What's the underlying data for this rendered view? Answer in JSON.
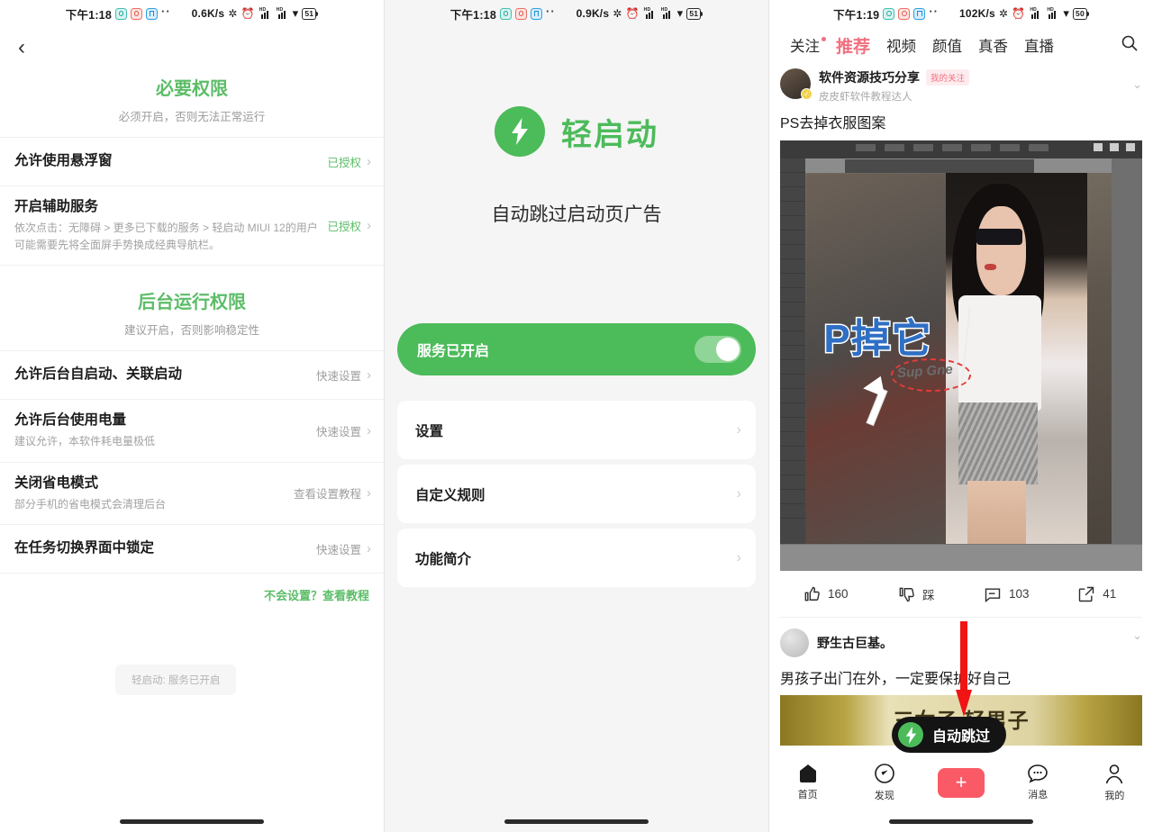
{
  "panel1": {
    "status": {
      "time": "下午1:18",
      "speed": "0.6K/s",
      "battery": "51"
    },
    "back_icon": "‹",
    "section1": {
      "title": "必要权限",
      "subtitle": "必须开启，否则无法正常运行"
    },
    "rows1": [
      {
        "title": "允许使用悬浮窗",
        "desc": "",
        "action": "已授权",
        "action_style": "green"
      },
      {
        "title": "开启辅助服务",
        "desc": "依次点击：无障碍 > 更多已下载的服务 > 轻启动 MIUI 12的用户可能需要先将全面屏手势换成经典导航栏。",
        "action": "已授权",
        "action_style": "green"
      }
    ],
    "section2": {
      "title": "后台运行权限",
      "subtitle": "建议开启，否则影响稳定性"
    },
    "rows2": [
      {
        "title": "允许后台自启动、关联启动",
        "desc": "",
        "action": "快速设置",
        "action_style": "grey"
      },
      {
        "title": "允许后台使用电量",
        "desc": "建议允许，本软件耗电量极低",
        "action": "快速设置",
        "action_style": "grey"
      },
      {
        "title": "关闭省电模式",
        "desc": "部分手机的省电模式会清理后台",
        "action": "查看设置教程",
        "action_style": "grey"
      },
      {
        "title": "在任务切换界面中锁定",
        "desc": "",
        "action": "快速设置",
        "action_style": "grey"
      }
    ],
    "tutorial_link": "不会设置？查看教程",
    "toast": "轻启动: 服务已开启"
  },
  "panel2": {
    "status": {
      "time": "下午1:18",
      "speed": "0.9K/s",
      "battery": "51"
    },
    "brand_name": "轻启动",
    "brand_icon": "lightning-bolt-icon",
    "tagline": "自动跳过启动页广告",
    "master_switch": {
      "label": "服务已开启",
      "enabled": true
    },
    "menu": [
      {
        "label": "设置"
      },
      {
        "label": "自定义规则"
      },
      {
        "label": "功能简介"
      }
    ]
  },
  "panel3": {
    "status": {
      "time": "下午1:19",
      "speed": "102K/s",
      "battery": "50"
    },
    "tabs": [
      {
        "label": "关注",
        "active": false,
        "dot": true
      },
      {
        "label": "推荐",
        "active": true,
        "dot": false
      },
      {
        "label": "视频",
        "active": false,
        "dot": false
      },
      {
        "label": "颜值",
        "active": false,
        "dot": false
      },
      {
        "label": "真香",
        "active": false,
        "dot": false
      },
      {
        "label": "直播",
        "active": false,
        "dot": false
      }
    ],
    "search_icon": "search-icon",
    "post1": {
      "author": "软件资源技巧分享",
      "badge": "我的关注",
      "desc": "皮皮虾软件教程达人",
      "title": "PS去掉衣服图案",
      "media_overlay_text": "P掉它",
      "media_graffiti_text": "Sup Gne",
      "actions": [
        {
          "icon": "thumbs-up-icon",
          "label": "160"
        },
        {
          "icon": "thumbs-down-icon",
          "label": "踩"
        },
        {
          "icon": "comment-icon",
          "label": "103"
        },
        {
          "icon": "share-icon",
          "label": "41"
        }
      ]
    },
    "post2": {
      "author": "野生古巨基。",
      "title": "男孩子出门在外，一定要保护好自己",
      "banner_text": "三女子      轻男子"
    },
    "float_pill": {
      "label": "自动跳过",
      "icon": "lightning-bolt-icon"
    },
    "bottom_nav": [
      {
        "label": "首页",
        "icon": "home-icon",
        "active": true
      },
      {
        "label": "发现",
        "icon": "compass-icon",
        "active": false
      },
      {
        "label": "",
        "icon": "plus-icon",
        "active": false
      },
      {
        "label": "消息",
        "icon": "message-icon",
        "active": false
      },
      {
        "label": "我的",
        "icon": "person-icon",
        "active": false
      }
    ]
  },
  "colors": {
    "green": "#4cbb5a",
    "pink": "#f2707f",
    "red": "#fa5a66"
  }
}
